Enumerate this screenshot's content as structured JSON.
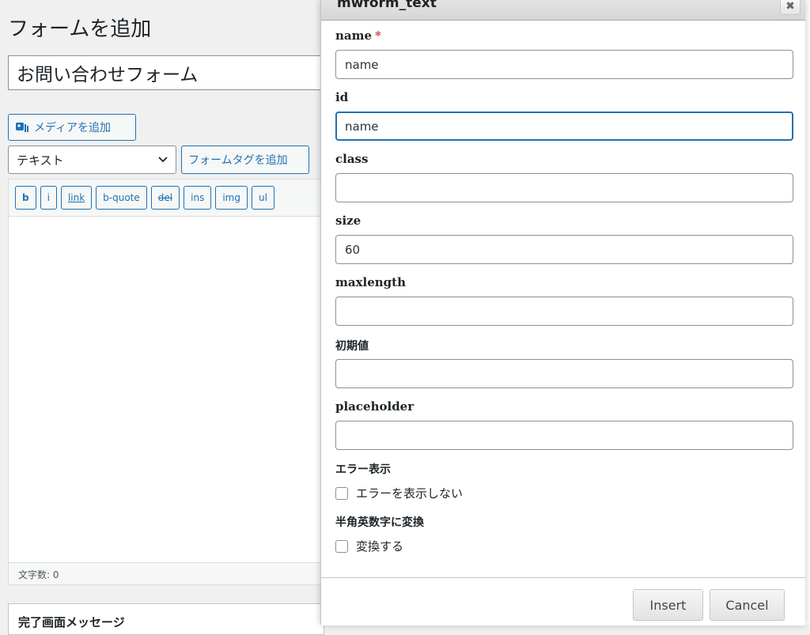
{
  "background": {
    "page_title": "フォームを追加",
    "title_value": "お問い合わせフォーム",
    "media_button": "メディアを追加",
    "format_select": "テキスト",
    "form_tag_button": "フォームタグを追加",
    "quicktags": [
      "b",
      "i",
      "link",
      "b-quote",
      "del",
      "ins",
      "img",
      "ul"
    ],
    "word_count": "文字数: 0",
    "metabox_title": "完了画面メッセージ"
  },
  "modal": {
    "title": "mwform_text",
    "close": "✖",
    "fields": {
      "name": {
        "label": "name",
        "required_mark": "*",
        "value": "name"
      },
      "id": {
        "label": "id",
        "value": "name"
      },
      "class": {
        "label": "class",
        "value": ""
      },
      "size": {
        "label": "size",
        "value": "60"
      },
      "maxlength": {
        "label": "maxlength",
        "value": ""
      },
      "default": {
        "label": "初期値",
        "value": ""
      },
      "placeholder": {
        "label": "placeholder",
        "value": ""
      }
    },
    "error_section": {
      "label": "エラー表示",
      "checkbox_label": "エラーを表示しない",
      "checked": false
    },
    "convert_section": {
      "label": "半角英数字に変換",
      "checkbox_label": "変換する",
      "checked": false
    },
    "insert_button": "Insert",
    "cancel_button": "Cancel"
  },
  "colors": {
    "accent": "#2271b1",
    "required": "#d63638"
  }
}
